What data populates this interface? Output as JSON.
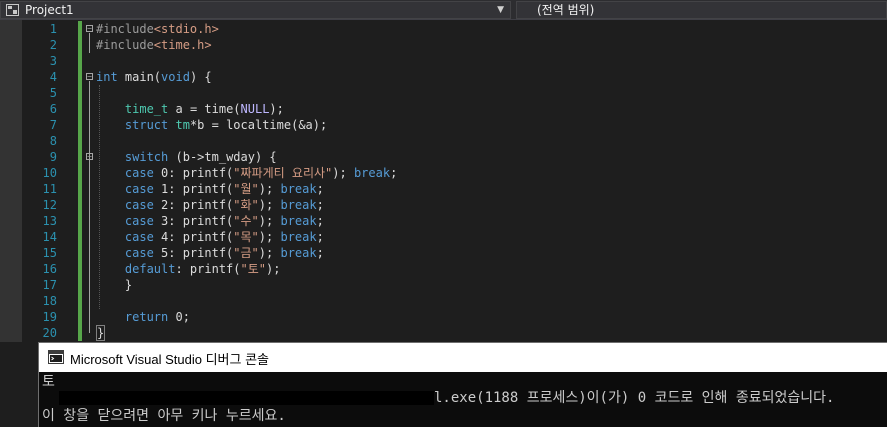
{
  "navbar": {
    "project": "Project1",
    "scope": "(전역 범위)"
  },
  "editor": {
    "lines": [
      {
        "n": "1",
        "tokens": [
          {
            "t": "#include",
            "c": "pp"
          },
          {
            "t": "<stdio.h>",
            "c": "hdr"
          }
        ]
      },
      {
        "n": "2",
        "tokens": [
          {
            "t": "#include",
            "c": "pp"
          },
          {
            "t": "<time.h>",
            "c": "hdr"
          }
        ]
      },
      {
        "n": "3",
        "tokens": []
      },
      {
        "n": "4",
        "tokens": [
          {
            "t": "int",
            "c": "kw"
          },
          {
            "t": " main("
          },
          {
            "t": "void",
            "c": "kw"
          },
          {
            "t": ") {"
          }
        ]
      },
      {
        "n": "5",
        "tokens": []
      },
      {
        "n": "6",
        "tokens": [
          {
            "t": "    "
          },
          {
            "t": "time_t",
            "c": "type"
          },
          {
            "t": " a = time("
          },
          {
            "t": "NULL",
            "c": "macro"
          },
          {
            "t": ");"
          }
        ]
      },
      {
        "n": "7",
        "tokens": [
          {
            "t": "    "
          },
          {
            "t": "struct",
            "c": "kw"
          },
          {
            "t": " "
          },
          {
            "t": "tm",
            "c": "type"
          },
          {
            "t": "*b = localtime(&a);"
          }
        ]
      },
      {
        "n": "8",
        "tokens": []
      },
      {
        "n": "9",
        "tokens": [
          {
            "t": "    "
          },
          {
            "t": "switch",
            "c": "kw"
          },
          {
            "t": " (b->tm_wday) {"
          }
        ]
      },
      {
        "n": "10",
        "tokens": [
          {
            "t": "    "
          },
          {
            "t": "case",
            "c": "kw"
          },
          {
            "t": " 0: printf("
          },
          {
            "t": "\"짜파게티 요리사\"",
            "c": "str"
          },
          {
            "t": "); "
          },
          {
            "t": "break",
            "c": "brk"
          },
          {
            "t": ";"
          }
        ]
      },
      {
        "n": "11",
        "tokens": [
          {
            "t": "    "
          },
          {
            "t": "case",
            "c": "kw"
          },
          {
            "t": " 1: printf("
          },
          {
            "t": "\"월\"",
            "c": "str"
          },
          {
            "t": "); "
          },
          {
            "t": "break",
            "c": "brk"
          },
          {
            "t": ";"
          }
        ]
      },
      {
        "n": "12",
        "tokens": [
          {
            "t": "    "
          },
          {
            "t": "case",
            "c": "kw"
          },
          {
            "t": " 2: printf("
          },
          {
            "t": "\"화\"",
            "c": "str"
          },
          {
            "t": "); "
          },
          {
            "t": "break",
            "c": "brk"
          },
          {
            "t": ";"
          }
        ]
      },
      {
        "n": "13",
        "tokens": [
          {
            "t": "    "
          },
          {
            "t": "case",
            "c": "kw"
          },
          {
            "t": " 3: printf("
          },
          {
            "t": "\"수\"",
            "c": "str"
          },
          {
            "t": "); "
          },
          {
            "t": "break",
            "c": "brk"
          },
          {
            "t": ";"
          }
        ]
      },
      {
        "n": "14",
        "tokens": [
          {
            "t": "    "
          },
          {
            "t": "case",
            "c": "kw"
          },
          {
            "t": " 4: printf("
          },
          {
            "t": "\"목\"",
            "c": "str"
          },
          {
            "t": "); "
          },
          {
            "t": "break",
            "c": "brk"
          },
          {
            "t": ";"
          }
        ]
      },
      {
        "n": "15",
        "tokens": [
          {
            "t": "    "
          },
          {
            "t": "case",
            "c": "kw"
          },
          {
            "t": " 5: printf("
          },
          {
            "t": "\"금\"",
            "c": "str"
          },
          {
            "t": "); "
          },
          {
            "t": "break",
            "c": "brk"
          },
          {
            "t": ";"
          }
        ]
      },
      {
        "n": "16",
        "tokens": [
          {
            "t": "    "
          },
          {
            "t": "default",
            "c": "kw"
          },
          {
            "t": ": printf("
          },
          {
            "t": "\"토\"",
            "c": "str"
          },
          {
            "t": ");"
          }
        ]
      },
      {
        "n": "17",
        "tokens": [
          {
            "t": "    }"
          }
        ]
      },
      {
        "n": "18",
        "tokens": []
      },
      {
        "n": "19",
        "tokens": [
          {
            "t": "    "
          },
          {
            "t": "return",
            "c": "kw"
          },
          {
            "t": " 0;"
          }
        ]
      },
      {
        "n": "20",
        "tokens": [
          {
            "t": "}",
            "c": "bracebox"
          }
        ]
      }
    ]
  },
  "console": {
    "title": "Microsoft Visual Studio 디버그 콘솔",
    "output_line1": "토",
    "output_line2": "l.exe(1188 프로세스)이(가) 0 코드로 인해 종료되었습니다.",
    "output_line3": "이 창을 닫으려면 아무 키나 누르세요."
  },
  "colors": {
    "keyword": "#569cd6",
    "string": "#d69d85",
    "type": "#4ec9b0",
    "line_number": "#2b91af",
    "change_marker": "#57a64a"
  }
}
